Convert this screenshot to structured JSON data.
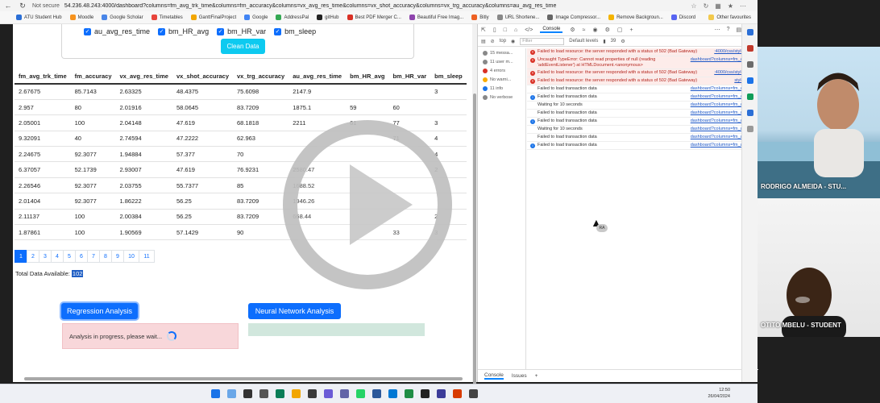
{
  "browser": {
    "security": "Not secure",
    "url": "54.236.48.243:4000/dashboard?columns=fm_avg_trk_time&columns=fm_accuracy&columns=vx_avg_res_time&columns=vx_shot_accuracy&columns=vx_trg_accuracy&columns=au_avg_res_time",
    "bookmarks": [
      "ATU Student Hub",
      "Moodle",
      "Google Scholar",
      "Timetables",
      "GanttFinalProject",
      "Google",
      "AddressPal",
      "gitHub",
      "Best PDF Merger C...",
      "Beautiful Free Imag...",
      "Bitly",
      "URL Shortene...",
      "Image Compressor...",
      "Remove Backgroun...",
      "Discord"
    ],
    "other_favourites": "Other favourites"
  },
  "filters": {
    "checkboxes": [
      "au_avg_res_time",
      "bm_HR_avg",
      "bm_HR_var",
      "bm_sleep"
    ],
    "clean_button": "Clean Data"
  },
  "table": {
    "headers": [
      "fm_avg_trk_time",
      "fm_accuracy",
      "vx_avg_res_time",
      "vx_shot_accuracy",
      "vx_trg_accuracy",
      "au_avg_res_time",
      "bm_HR_avg",
      "bm_HR_var",
      "bm_sleep"
    ],
    "rows": [
      [
        "2.67675",
        "85.7143",
        "2.63325",
        "48.4375",
        "75.6098",
        "2147.9",
        "",
        "",
        "3"
      ],
      [
        "2.957",
        "80",
        "2.01916",
        "58.0645",
        "83.7209",
        "1875.1",
        "59",
        "60",
        ""
      ],
      [
        "2.05001",
        "100",
        "2.04148",
        "47.619",
        "68.1818",
        "2211",
        "61",
        "77",
        "3"
      ],
      [
        "9.32091",
        "40",
        "2.74594",
        "47.2222",
        "62.963",
        "",
        "",
        "71",
        "4"
      ],
      [
        "2.24675",
        "92.3077",
        "1.94884",
        "57.377",
        "70",
        "",
        "",
        "",
        "4"
      ],
      [
        "6.37057",
        "52.1739",
        "2.93007",
        "47.619",
        "76.9231",
        "2580.47",
        "",
        "",
        "2"
      ],
      [
        "2.26546",
        "92.3077",
        "2.03755",
        "55.7377",
        "85",
        "1688.52",
        "",
        "",
        ""
      ],
      [
        "2.01404",
        "92.3077",
        "1.86222",
        "56.25",
        "83.7209",
        "1946.26",
        "",
        "",
        ""
      ],
      [
        "2.11137",
        "100",
        "2.00384",
        "56.25",
        "83.7209",
        "668.44",
        "",
        "",
        "2"
      ],
      [
        "1.87861",
        "100",
        "1.90569",
        "57.1429",
        "90",
        "",
        "",
        "33",
        "3"
      ]
    ]
  },
  "pagination": [
    "1",
    "2",
    "3",
    "4",
    "5",
    "6",
    "7",
    "8",
    "9",
    "10",
    "11"
  ],
  "total": {
    "label": "Total Data Available:",
    "value": "102"
  },
  "analysis": {
    "regression_button": "Regression Analysis",
    "neural_button": "Neural Network Analysis",
    "regression_status": "Analysis in progress, please wait..."
  },
  "devtools": {
    "console_tab": "Console",
    "context": "top",
    "filter_placeholder": "Filter",
    "levels": "Default levels",
    "issues_count": "39",
    "sidebar": [
      {
        "label": "15 messa...",
        "color": "#888"
      },
      {
        "label": "11 user m...",
        "color": "#888"
      },
      {
        "label": "4 errors",
        "color": "#d93025"
      },
      {
        "label": "No warni...",
        "color": "#f9ab00"
      },
      {
        "label": "11 info",
        "color": "#1a73e8"
      },
      {
        "label": "No verbose",
        "color": "#888"
      }
    ],
    "logs": [
      {
        "type": "err",
        "msg": "Failed to load resource: the server responded with a status of 502 (Bad Gateway)",
        "src": ":4000/css/style.css:1"
      },
      {
        "type": "err",
        "msg": "Uncaught TypeError: Cannot read properties of null (reading 'addEventListener') at HTMLDocument.<anonymous>",
        "src": "dashboard?columns=fm_a...:919"
      },
      {
        "type": "err",
        "msg": "Failed to load resource: the server responded with a status of 502 (Bad Gateway)",
        "src": ":4000/css/style.css:1"
      },
      {
        "type": "err",
        "msg": "Failed to load resource: the server responded with a status of 502 (Bad Gateway)",
        "src": "style.css:1"
      },
      {
        "type": "log",
        "msg": "Failed to load transaction data",
        "src": "dashboard?columns=fm_a...:774"
      },
      {
        "type": "info",
        "msg": "Failed to load transaction data",
        "src": "dashboard?columns=fm_a...:774"
      },
      {
        "type": "log",
        "msg": "Waiting for 10 seconds",
        "src": "dashboard?columns=fm_a...:767"
      },
      {
        "type": "log",
        "msg": "Failed to load transaction data",
        "src": "dashboard?columns=fm_a...:774"
      },
      {
        "type": "info",
        "msg": "Failed to load transaction data",
        "src": "dashboard?columns=fm_a...:774"
      },
      {
        "type": "log",
        "msg": "Waiting for 10 seconds",
        "src": "dashboard?columns=fm_a...:767"
      },
      {
        "type": "log",
        "msg": "Failed to load transaction data",
        "src": "dashboard?columns=fm_a...:774"
      },
      {
        "type": "info",
        "msg": "Failed to load transaction data",
        "src": "dashboard?columns=fm_a...:774"
      }
    ],
    "bottom_tabs": [
      "Console",
      "Issues"
    ]
  },
  "participants": [
    {
      "name": "RODRIGO ALMEIDA - STU..."
    },
    {
      "name": "OTITO MBELU - STUDENT"
    }
  ],
  "cursor_badge": "RA",
  "clock": {
    "time": "12:50",
    "date": "26/04/2024"
  }
}
